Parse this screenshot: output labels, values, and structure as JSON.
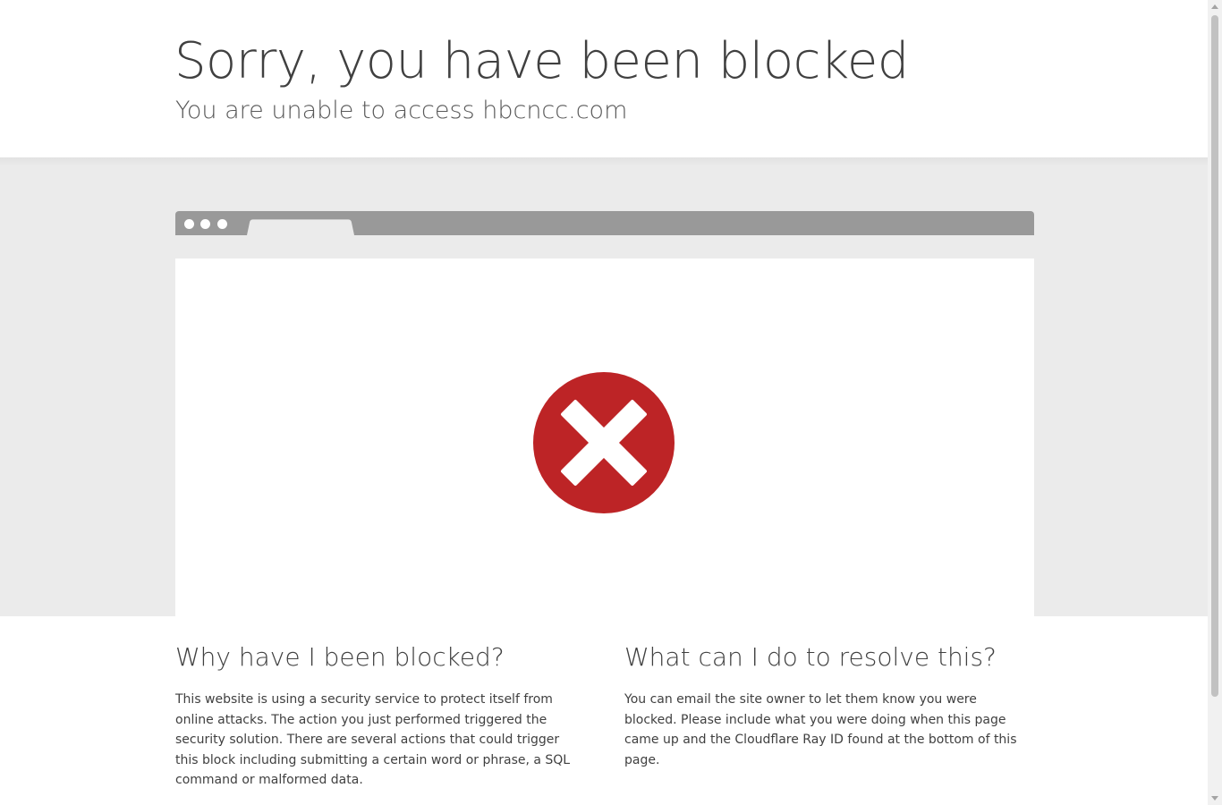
{
  "header": {
    "title": "Sorry, you have been blocked",
    "subtitle": "You are unable to access hbcncc.com"
  },
  "illustration": {
    "icon": "error-x-circle-icon",
    "icon_color": "#bd2426"
  },
  "why_blocked": {
    "heading": "Why have I been blocked?",
    "body": "This website is using a security service to protect itself from online attacks. The action you just performed triggered the security solution. There are several actions that could trigger this block including submitting a certain word or phrase, a SQL command or malformed data."
  },
  "resolve": {
    "heading": "What can I do to resolve this?",
    "body": "You can email the site owner to let them know you were blocked. Please include what you were doing when this page came up and the Cloudflare Ray ID found at the bottom of this page."
  }
}
